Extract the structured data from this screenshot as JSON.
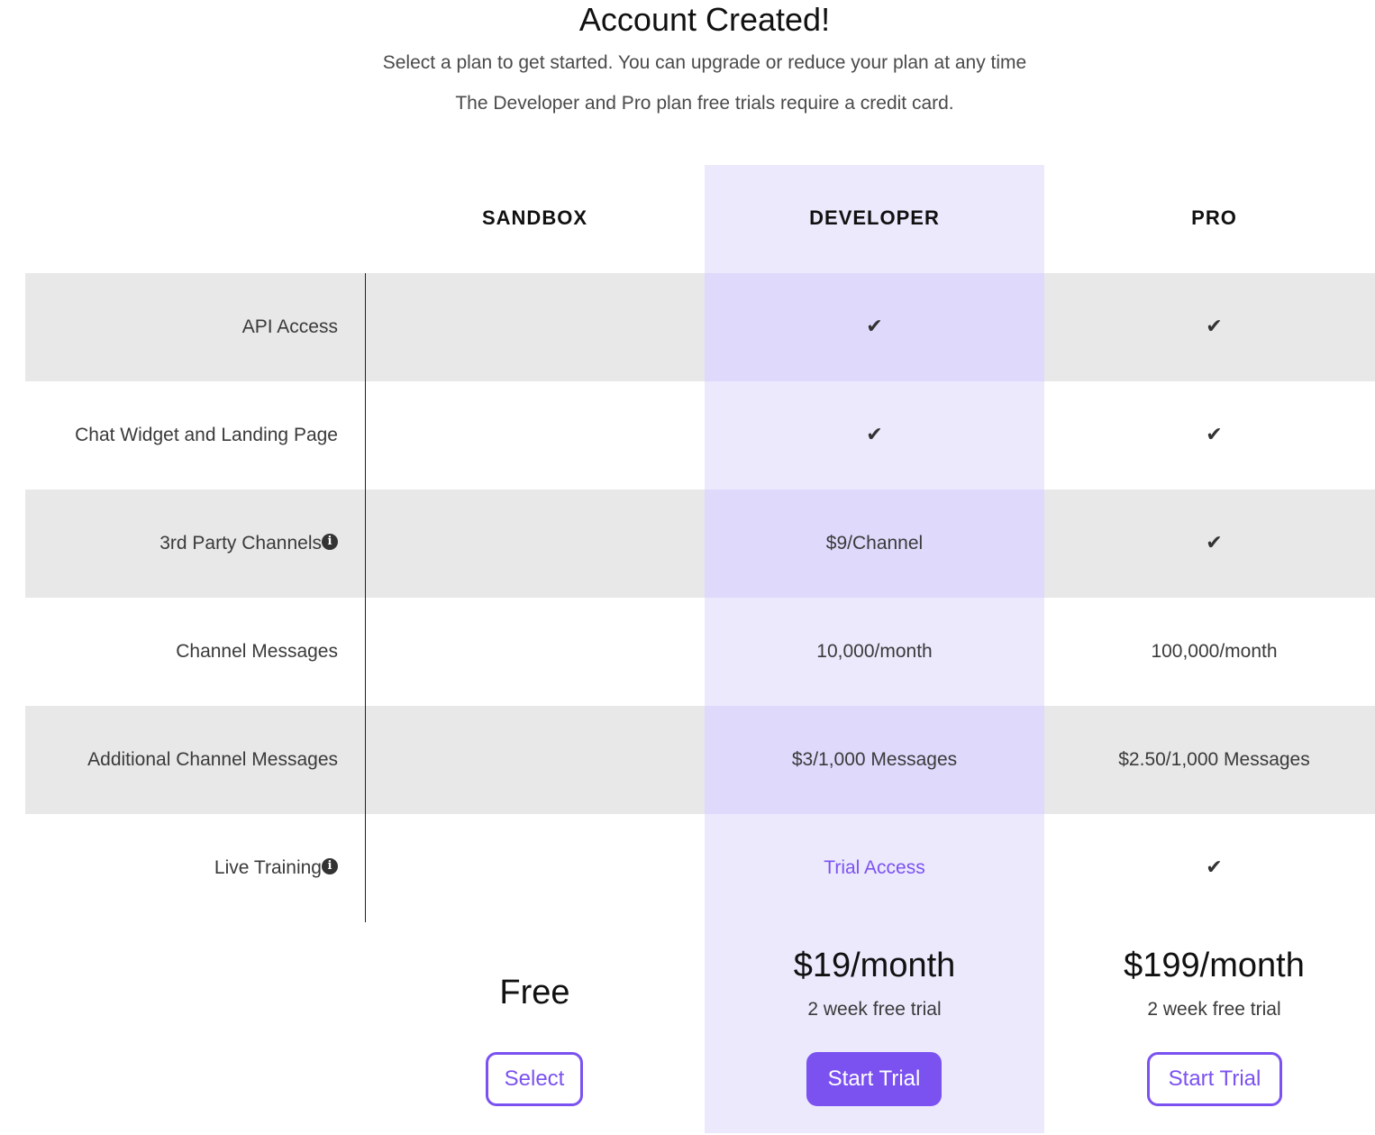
{
  "header": {
    "title": "Account Created!",
    "subtitle_line1": "Select a plan to get started. You can upgrade or reduce your plan at any time",
    "subtitle_line2": "The Developer and Pro plan free trials require a credit card."
  },
  "plans": {
    "sandbox": {
      "name": "SANDBOX",
      "price": "Free",
      "button": "Select"
    },
    "developer": {
      "name": "DEVELOPER",
      "price": "$19/month",
      "trial_note": "2 week free trial",
      "button": "Start Trial"
    },
    "pro": {
      "name": "PRO",
      "price": "$199/month",
      "trial_note": "2 week free trial",
      "button": "Start Trial"
    }
  },
  "features": [
    {
      "label": "API Access",
      "info": false,
      "sandbox": "",
      "developer": "✔",
      "pro": "✔"
    },
    {
      "label": "Chat Widget and Landing Page",
      "info": false,
      "sandbox": "",
      "developer": "✔",
      "pro": "✔"
    },
    {
      "label": "3rd Party Channels",
      "info": true,
      "sandbox": "",
      "developer": "$9/Channel",
      "pro": "✔"
    },
    {
      "label": "Channel Messages",
      "info": false,
      "sandbox": "",
      "developer": "10,000/month",
      "pro": "100,000/month"
    },
    {
      "label": "Additional Channel Messages",
      "info": false,
      "sandbox": "",
      "developer": "$3/1,000 Messages",
      "pro": "$2.50/1,000 Messages"
    },
    {
      "label": "Live Training",
      "info": true,
      "sandbox": "",
      "developer": "Trial Access",
      "pro": "✔"
    }
  ],
  "icons": {
    "info": "i",
    "check": "✔"
  },
  "colors": {
    "accent": "#7b52f0",
    "developer_column": "#ece9fd",
    "developer_column_shaded": "#dfd9fc",
    "row_shaded": "#e8e8e8"
  }
}
